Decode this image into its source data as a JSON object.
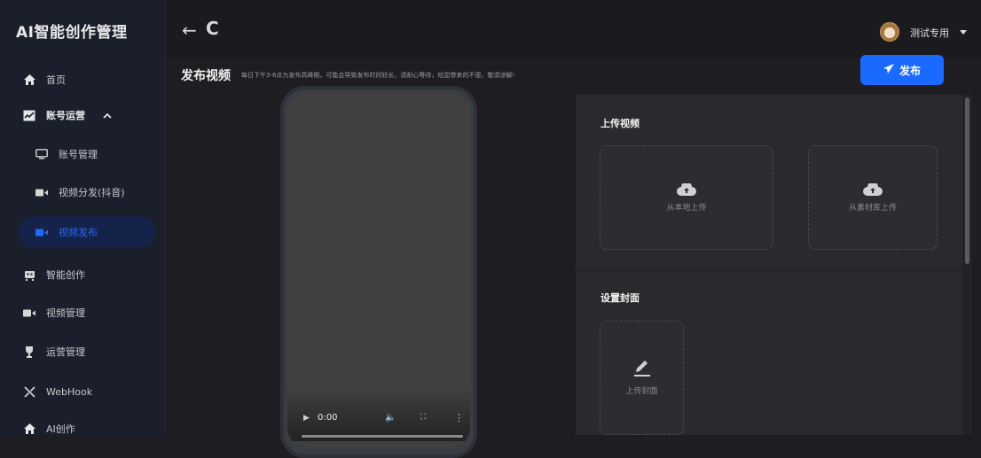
{
  "brand": "AI智能创作管理",
  "sidebar": {
    "items": [
      {
        "label": "首页",
        "icon": "home-icon"
      },
      {
        "label": "账号运营",
        "icon": "chart-icon",
        "expanded": true
      },
      {
        "label": "账号管理",
        "icon": "monitor-icon"
      },
      {
        "label": "视频分发(抖音)",
        "icon": "video-camera-icon"
      },
      {
        "label": "视频发布",
        "icon": "video-camera-icon",
        "active": true
      },
      {
        "label": "智能创作",
        "icon": "robot-icon"
      },
      {
        "label": "视频管理",
        "icon": "video-camera-icon"
      },
      {
        "label": "运营管理",
        "icon": "trophy-icon"
      },
      {
        "label": "WebHook",
        "icon": "webhook-icon"
      },
      {
        "label": "AI创作",
        "icon": "home-icon"
      }
    ]
  },
  "topbar": {
    "back_icon": "←",
    "refresh_icon": "C",
    "username": "测试专用"
  },
  "page": {
    "title": "发布视频",
    "notice": "每日下午3-6点为发布高峰期，可能会导致发布时间较长，请耐心等待，给您带来的不便，敬请谅解!",
    "publish_label": "发布"
  },
  "player": {
    "time": "0:00"
  },
  "upload_video": {
    "title": "上传视频",
    "local_label": "从本地上传",
    "library_label": "从素材库上传"
  },
  "cover": {
    "title": "设置封面",
    "upload_label": "上传封面"
  },
  "colors": {
    "accent": "#1a6aff",
    "sidebar_bg": "#1b1f2b",
    "active_bg": "#15224a"
  }
}
